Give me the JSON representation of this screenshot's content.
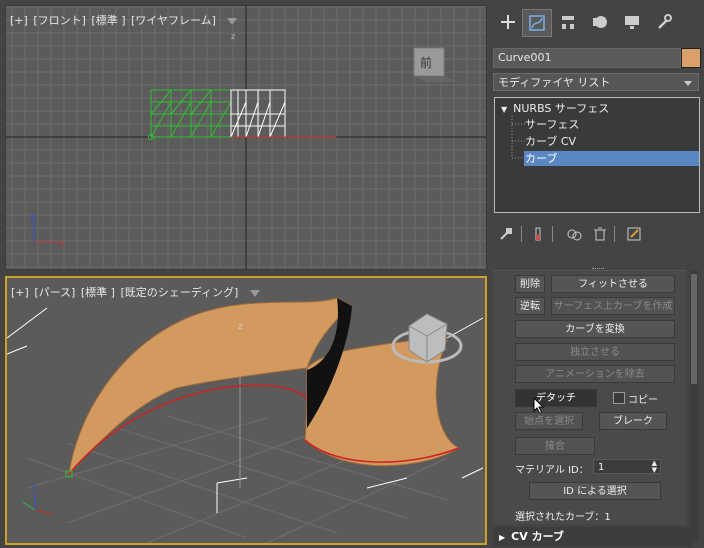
{
  "viewports": {
    "top": {
      "label": [
        "[+]",
        "[フロント]",
        "[標準 ]",
        "[ワイヤフレーム]"
      ],
      "axis_letter": "z",
      "viewcube_label": "前"
    },
    "persp": {
      "label": [
        "[+]",
        "[パース]",
        "[標準 ]",
        "[既定のシェーディング]"
      ],
      "axis_letter": "z"
    }
  },
  "panel": {
    "tabs": [
      "create-icon",
      "modify-icon",
      "hierarchy-icon",
      "motion-icon",
      "display-icon",
      "utilities-icon"
    ],
    "object_name": "Curve001",
    "object_color": "#d9a06a",
    "modifier_list": "モディファイヤ リスト",
    "stack": [
      "NURBS サーフェス",
      "サーフェス",
      "カーブ CV",
      "カーブ"
    ],
    "selected_stack_index": 3,
    "buttons": {
      "delete": "削除",
      "fit": "フィットさせる",
      "reverse": "逆転",
      "make_surface_curve": "サーフェス上カーブを作成",
      "convert_curve": "カーブを変換",
      "make_independent": "独立させる",
      "remove_animation": "アニメーションを除去",
      "detach": "デタッチ",
      "copy": "コピー",
      "select_start": "始点を選択",
      "break": "ブレーク",
      "join": "接合",
      "select_by_id": "ID による選択"
    },
    "material_id_label": "マテリアル ID：",
    "material_id_value": "1",
    "selected_curve_label": "選択されたカーブ：1",
    "next_rollout": "CV カーブ"
  }
}
